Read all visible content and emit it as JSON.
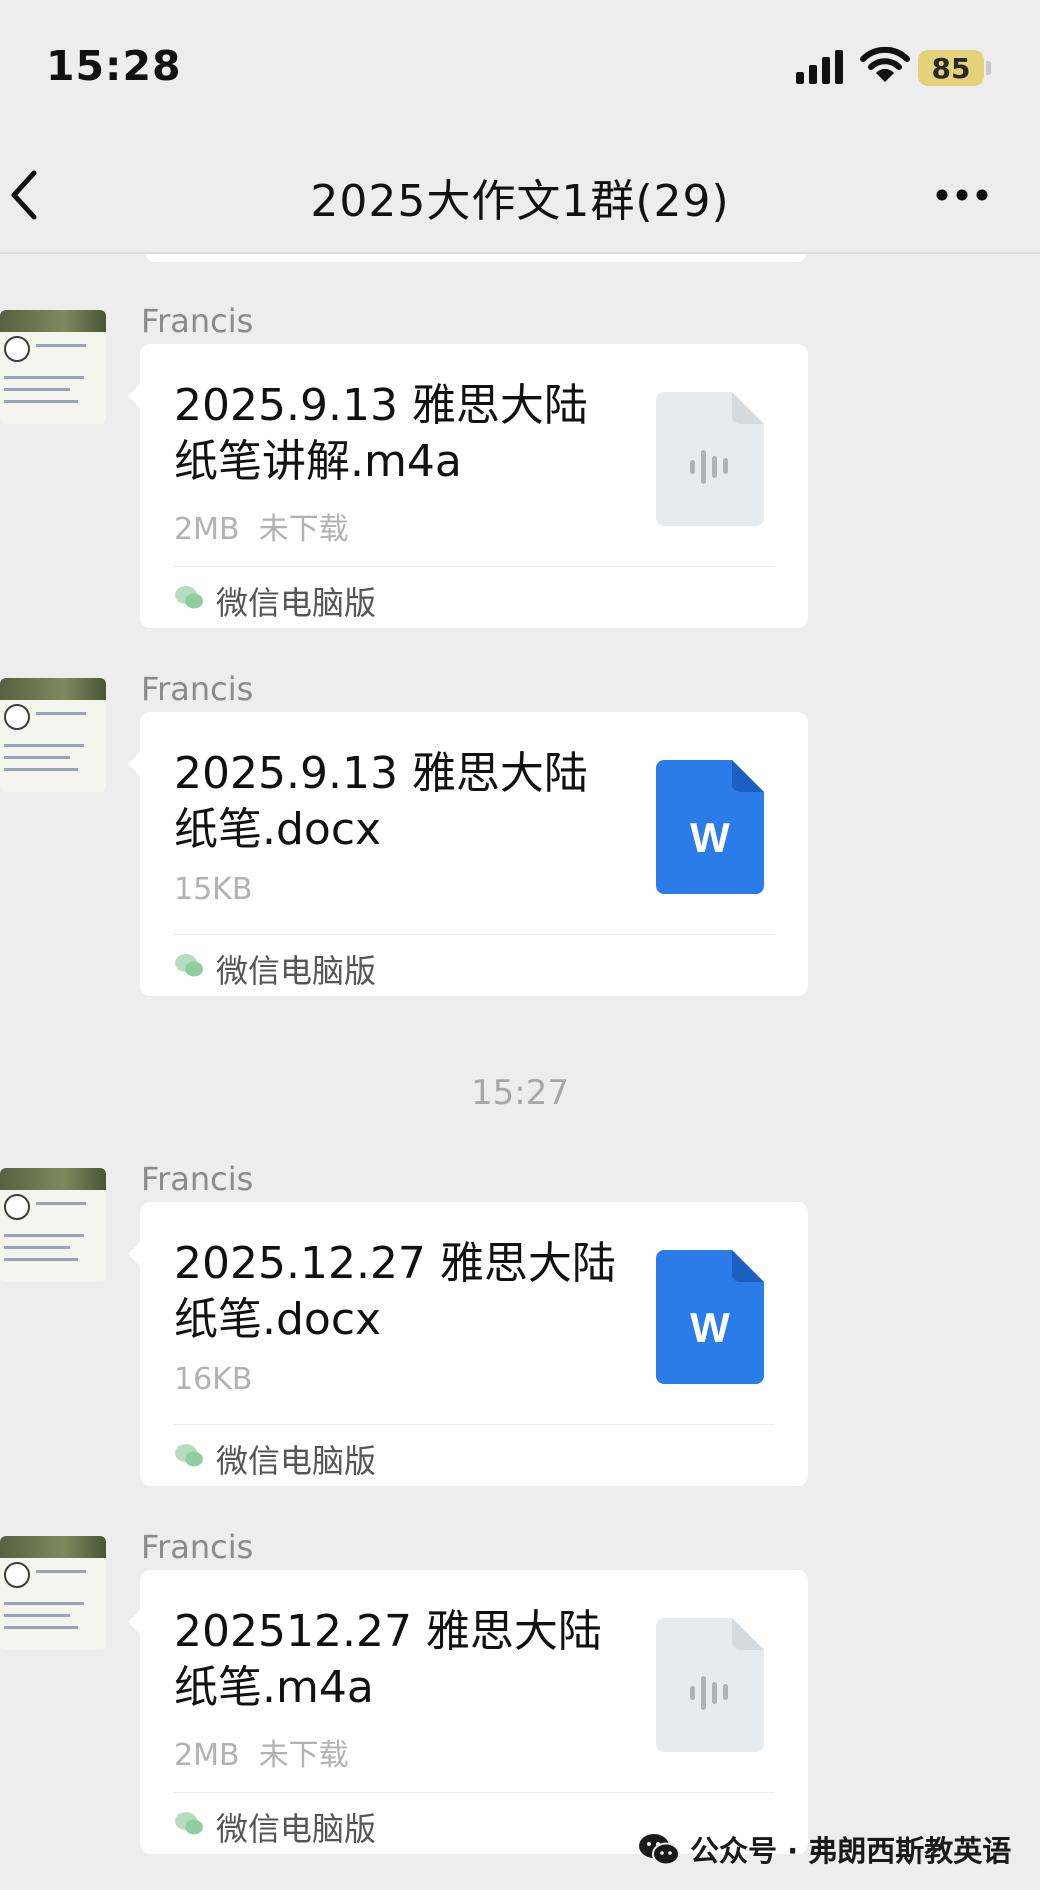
{
  "status_bar": {
    "time": "15:28",
    "battery_level": "85",
    "icons": [
      "signal-icon",
      "wifi-icon",
      "battery-icon"
    ]
  },
  "nav": {
    "title": "2025大作文1群(29)",
    "icons": [
      "back-icon",
      "more-icon"
    ]
  },
  "time_separator": "15:27",
  "messages": [
    {
      "sender": "Francis",
      "file_name": "2025.9.13 雅思大陆纸笔讲解.m4a",
      "file_meta": "2MB  未下载",
      "file_type": "audio",
      "source": "微信电脑版"
    },
    {
      "sender": "Francis",
      "file_name": "2025.9.13 雅思大陆纸笔.docx",
      "file_meta": "15KB",
      "file_type": "word",
      "source": "微信电脑版"
    },
    {
      "sender": "Francis",
      "file_name": "2025.12.27 雅思大陆纸笔.docx",
      "file_meta": "16KB",
      "file_type": "word",
      "source": "微信电脑版"
    },
    {
      "sender": "Francis",
      "file_name": "202512.27 雅思大陆纸笔.m4a",
      "file_meta": "2MB  未下载",
      "file_type": "audio",
      "source": "微信电脑版"
    }
  ],
  "watermark": {
    "text": "公众号 · 弗朗西斯教英语",
    "icon": "wechat-icon"
  },
  "colors": {
    "background": "#ededed",
    "card": "#ffffff",
    "word_icon": "#2b7ce9",
    "audio_icon": "#e8ebee",
    "wechat_green": "#07c160",
    "meta_text": "#b2b2b2"
  }
}
